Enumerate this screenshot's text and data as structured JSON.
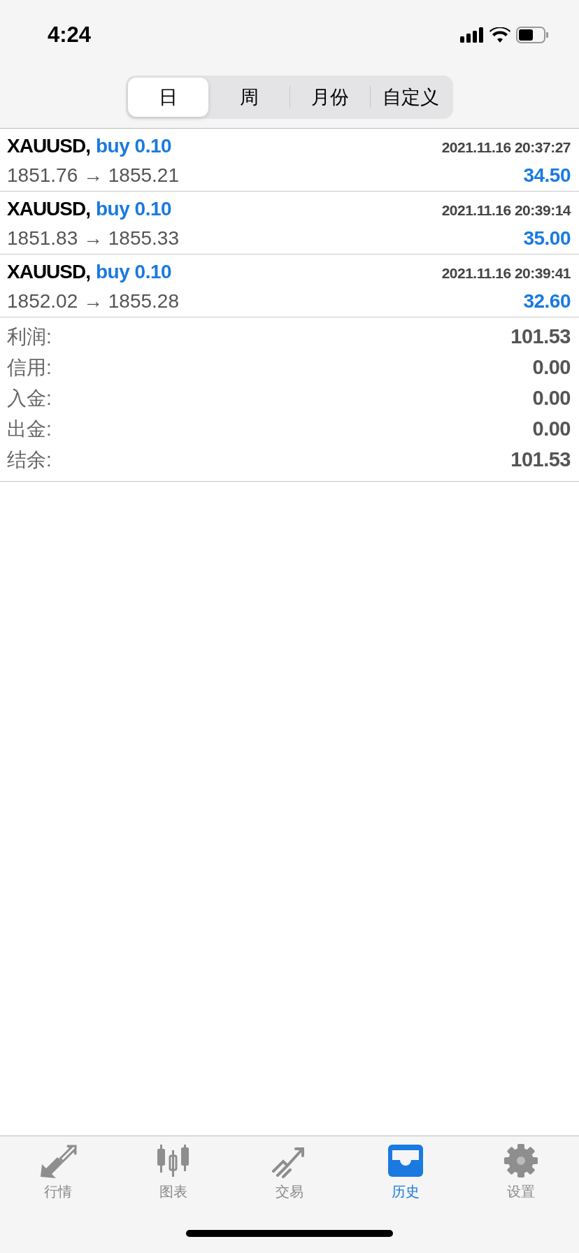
{
  "status_bar": {
    "time": "4:24"
  },
  "periods": [
    {
      "label": "日",
      "selected": true
    },
    {
      "label": "周",
      "selected": false
    },
    {
      "label": "月份",
      "selected": false
    },
    {
      "label": "自定义",
      "selected": false
    }
  ],
  "trades": [
    {
      "symbol": "XAUUSD,",
      "action": "buy 0.10",
      "time": "2021.11.16 20:37:27",
      "prices": "1851.76 → 1855.21",
      "profit": "34.50"
    },
    {
      "symbol": "XAUUSD,",
      "action": "buy 0.10",
      "time": "2021.11.16 20:39:14",
      "prices": "1851.83 → 1855.33",
      "profit": "35.00"
    },
    {
      "symbol": "XAUUSD,",
      "action": "buy 0.10",
      "time": "2021.11.16 20:39:41",
      "prices": "1852.02 → 1855.28",
      "profit": "32.60"
    }
  ],
  "summary": [
    {
      "label": "利润:",
      "value": "101.53"
    },
    {
      "label": "信用:",
      "value": "0.00"
    },
    {
      "label": "入金:",
      "value": "0.00"
    },
    {
      "label": "出金:",
      "value": "0.00"
    },
    {
      "label": "结余:",
      "value": "101.53"
    }
  ],
  "tab_bar": [
    {
      "label": "行情",
      "selected": false
    },
    {
      "label": "图表",
      "selected": false
    },
    {
      "label": "交易",
      "selected": false
    },
    {
      "label": "历史",
      "selected": true
    },
    {
      "label": "设置",
      "selected": false
    }
  ]
}
